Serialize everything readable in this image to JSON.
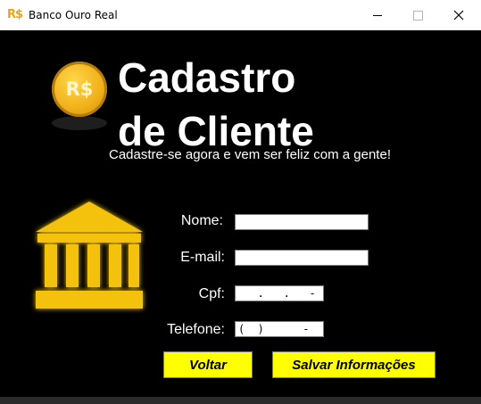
{
  "window": {
    "title": "Banco Ouro Real",
    "icon_text": "R$",
    "icon_name": "bank-logo-icon"
  },
  "header": {
    "coin_label": "R$",
    "title_line1": "Cadastro",
    "title_line2": "de Cliente",
    "subtitle": "Cadastre-se agora e vem ser feliz com a gente!"
  },
  "form": {
    "name_label": "Nome:",
    "name_value": "",
    "email_label": "E-mail:",
    "email_value": "",
    "cpf_label": "Cpf:",
    "cpf_value": "   .   .   -",
    "phone_label": "Telefone:",
    "phone_value": "(  )      -"
  },
  "buttons": {
    "back_label": "Voltar",
    "save_label": "Salvar Informações"
  },
  "colors": {
    "background": "#000000",
    "accent": "#ffff00",
    "gold": "#f1b21b"
  }
}
